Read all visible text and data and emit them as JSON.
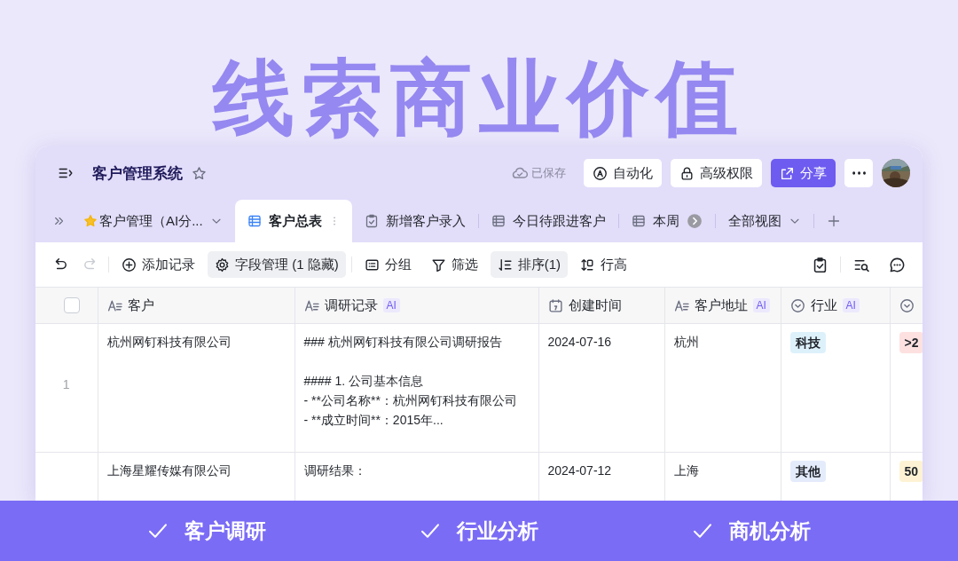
{
  "headline": "线索商业价值",
  "window": {
    "title": "客户管理系统",
    "starred": false,
    "save_status": "已保存",
    "actions": [
      {
        "label": "自动化",
        "kind": "automation"
      },
      {
        "label": "高级权限",
        "kind": "lock"
      },
      {
        "label": "分享",
        "kind": "share"
      }
    ],
    "tabs": [
      {
        "label": "客户管理（AI分...",
        "kind": "app",
        "selected": false
      },
      {
        "label": "客户总表",
        "kind": "grid",
        "selected": true
      },
      {
        "label": "新增客户录入",
        "kind": "form",
        "selected": false
      },
      {
        "label": "今日待跟进客户",
        "kind": "grid",
        "selected": false
      },
      {
        "label": "本周",
        "kind": "grid",
        "selected": false
      }
    ],
    "views_menu": "全部视图",
    "history": {
      "undo_disabled": false,
      "redo_disabled": true
    },
    "toolbar": [
      {
        "label": "添加记录",
        "kind": "add",
        "active": false
      },
      {
        "label": "字段管理 (1 隐藏)",
        "kind": "fields",
        "active": true
      },
      {
        "label": "分组",
        "kind": "group",
        "active": false
      },
      {
        "label": "筛选",
        "kind": "filter",
        "active": false
      },
      {
        "label": "排序(1)",
        "kind": "sort",
        "active": true
      },
      {
        "label": "行高",
        "kind": "height",
        "active": false
      }
    ],
    "table": {
      "select_all_checked": false,
      "columns": [
        {
          "label": "客户",
          "kind": "text"
        },
        {
          "label": "调研记录",
          "kind": "text",
          "ai_badge": "AI"
        },
        {
          "label": "创建时间",
          "kind": "date"
        },
        {
          "label": "客户地址",
          "kind": "text",
          "ai_badge": "AI"
        },
        {
          "label": "行业",
          "kind": "select",
          "ai_badge": "AI"
        },
        {
          "kind": "select"
        }
      ],
      "rows": [
        {
          "number": "1",
          "cells": [
            "杭州网钉科技有限公司",
            "### 杭州网钉科技有限公司调研报告\n\n#### 1. 公司基本信息\n- **公司名称**：杭州网钉科技有限公司\n- **成立时间**：2015年...",
            "2024-07-16",
            "杭州",
            {
              "text": "科技",
              "color": "#ddf1fb"
            },
            {
              "text": ">2",
              "color": "#fde1e1"
            }
          ]
        },
        {
          "cells": [
            "上海星耀传媒有限公司",
            "调研结果：",
            "2024-07-12",
            "上海",
            {
              "text": "其他",
              "color": "#e4ebfb"
            },
            {
              "text": "50",
              "color": "#fdf3d4"
            }
          ]
        }
      ]
    }
  },
  "features": [
    {
      "label": "客户调研"
    },
    {
      "label": "行业分析"
    },
    {
      "label": "商机分析"
    }
  ]
}
